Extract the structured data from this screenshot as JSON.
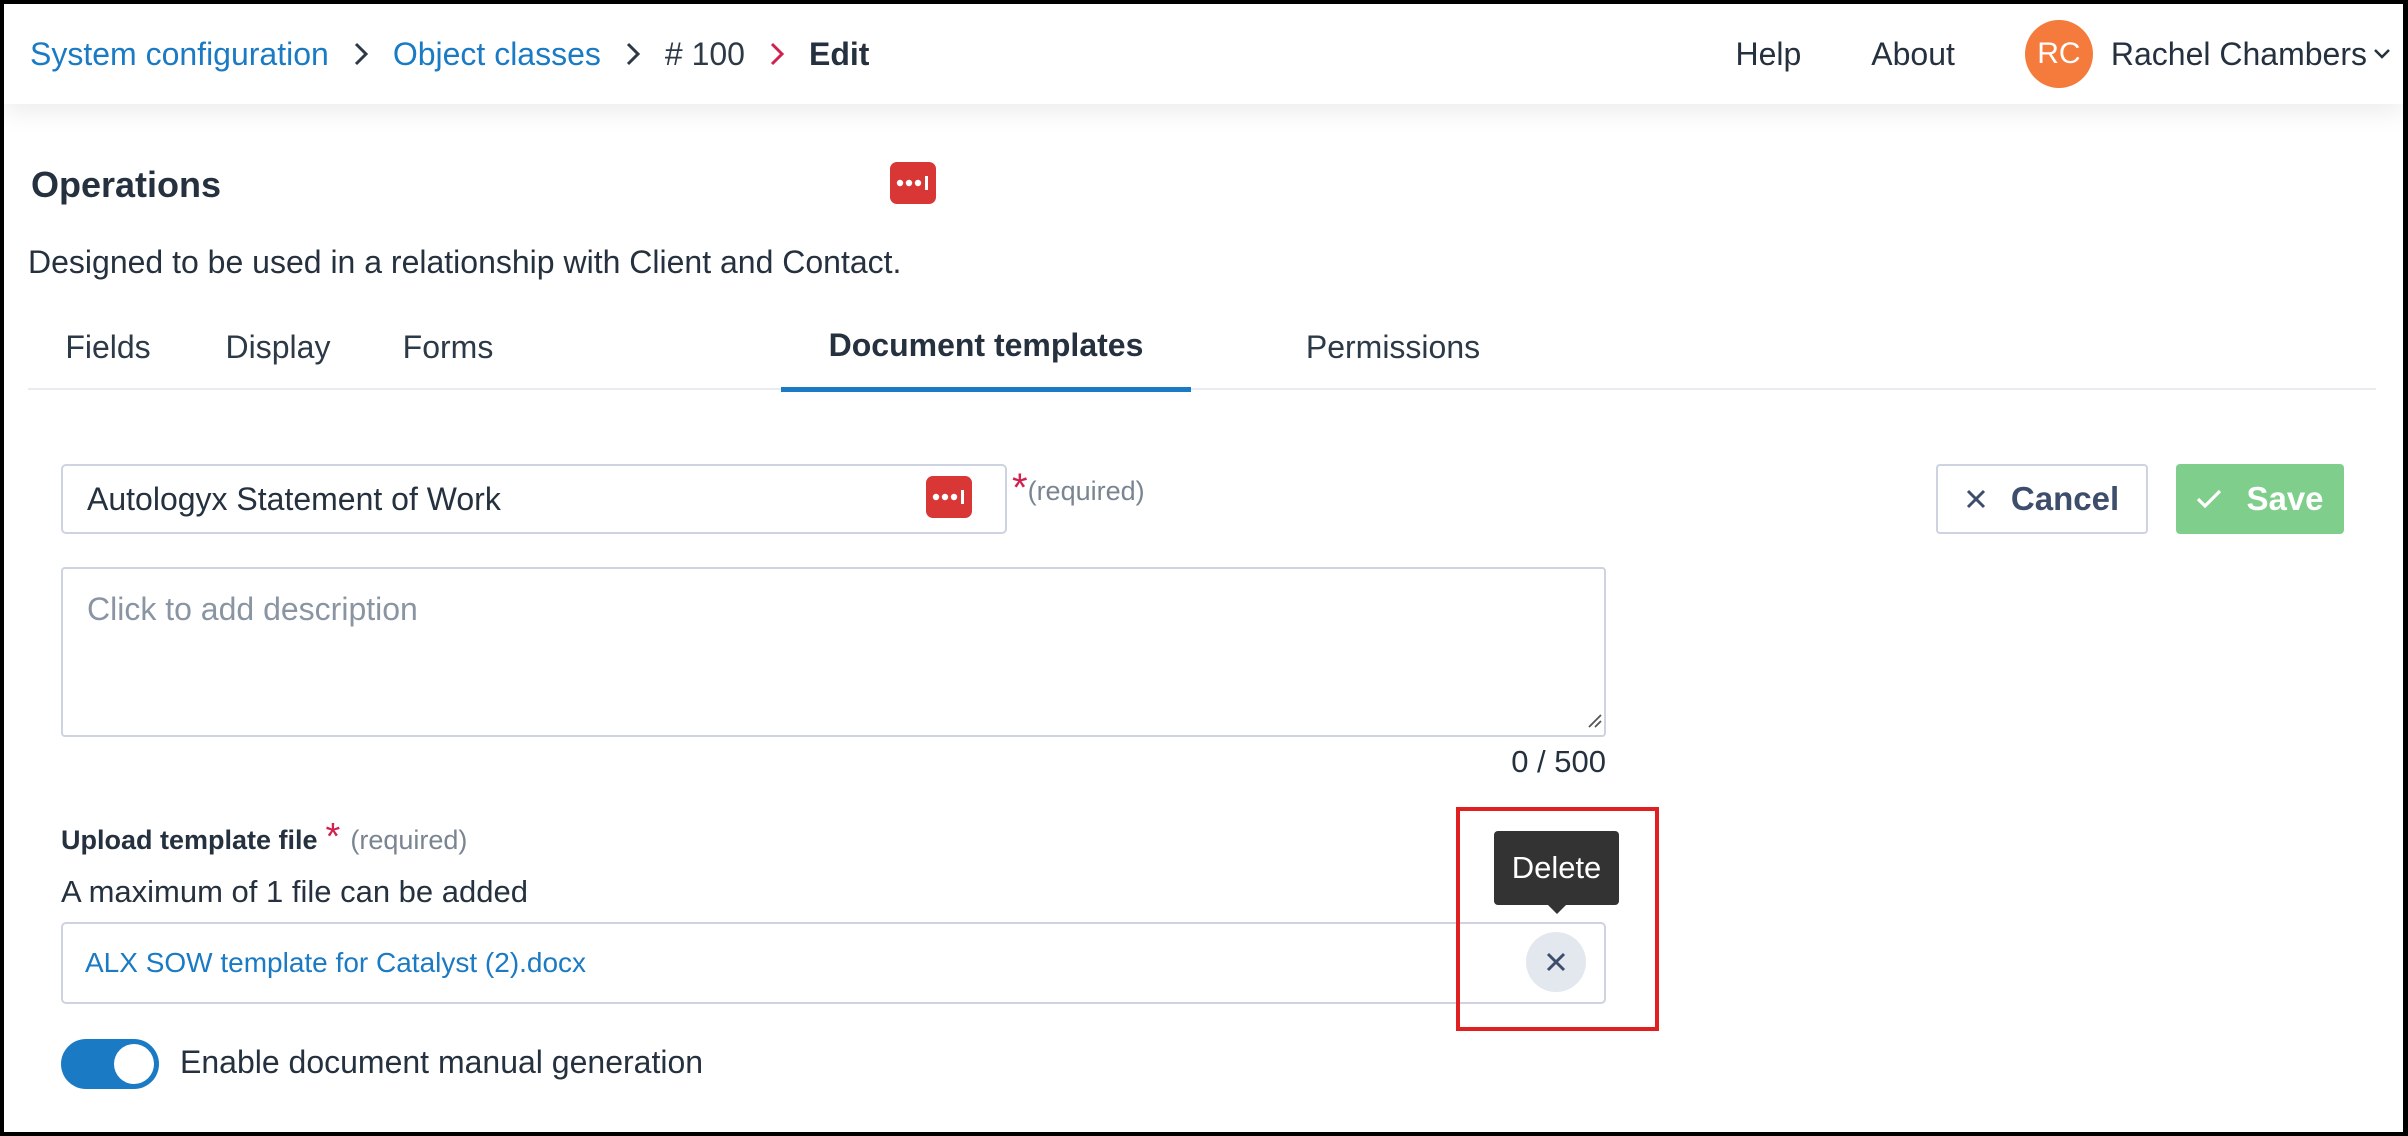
{
  "breadcrumb": {
    "items": [
      {
        "label": "System configuration"
      },
      {
        "label": "Object classes"
      },
      {
        "label": "# 100"
      },
      {
        "label": "Edit"
      }
    ]
  },
  "topnav": {
    "help": "Help",
    "about": "About",
    "user_initials": "RC",
    "user_name": "Rachel Chambers",
    "avatar_color": "#f47b3c"
  },
  "page": {
    "title": "Operations",
    "description": "Designed to be used in a relationship with Client and Contact."
  },
  "tabs": [
    {
      "label": "Fields"
    },
    {
      "label": "Display"
    },
    {
      "label": "Forms"
    },
    {
      "label": "Document templates",
      "active": true
    },
    {
      "label": "Permissions"
    }
  ],
  "form": {
    "name_value": "Autology­x Statement of Work",
    "required_star": "*",
    "required_text": "(required)",
    "description_placeholder": "Click to add description",
    "char_count": "0 / 500",
    "upload_label": "Upload template file",
    "upload_required": "(required)",
    "max_files_text": "A maximum of 1 file can be added",
    "file_name": "ALX SOW template for Catalyst (2).docx",
    "delete_tooltip": "Delete",
    "manual_generation_label": "Enable document manual generation",
    "manual_generation_enabled": true
  },
  "actions": {
    "cancel": "Cancel",
    "save": "Save"
  },
  "colors": {
    "accent": "#1a7ac4",
    "save": "#7fce8b",
    "password_badge": "#d93636",
    "highlight": "#e02020"
  },
  "icons": {
    "breadcrumb_separator": "chevron-right-icon",
    "cancel": "close-icon",
    "save": "check-icon",
    "delete": "close-icon",
    "user_menu": "chevron-down-icon",
    "password_manager": "password-manager-icon"
  }
}
